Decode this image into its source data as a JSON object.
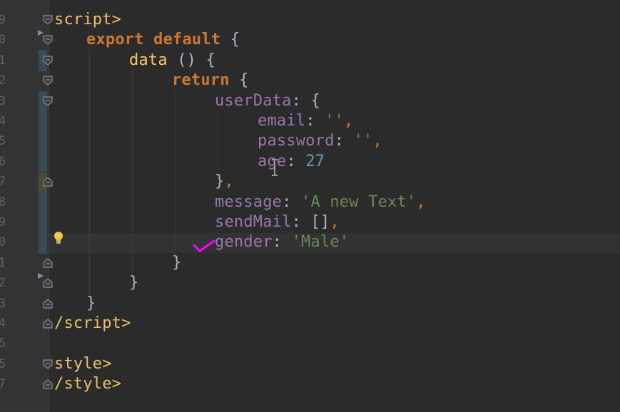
{
  "editor": {
    "line_numbers": [
      "9",
      "0",
      "1",
      "2",
      "3",
      "4",
      "5",
      "6",
      "7",
      "8",
      "9",
      "0",
      "1",
      "2",
      "3",
      "4",
      "5",
      "5",
      "7"
    ],
    "lines": [
      {
        "tokens": [
          {
            "t": "script>",
            "c": "tag"
          }
        ]
      },
      {
        "tokens": [
          {
            "t": "export ",
            "c": "kw"
          },
          {
            "t": "default ",
            "c": "kw"
          },
          {
            "t": "{",
            "c": "plain"
          }
        ]
      },
      {
        "tokens": [
          {
            "t": "data ",
            "c": "fn"
          },
          {
            "t": "() {",
            "c": "plain"
          }
        ]
      },
      {
        "tokens": [
          {
            "t": "return ",
            "c": "kw"
          },
          {
            "t": "{",
            "c": "plain"
          }
        ]
      },
      {
        "tokens": [
          {
            "t": "userData",
            "c": "prop"
          },
          {
            "t": ": {",
            "c": "plain"
          }
        ]
      },
      {
        "tokens": [
          {
            "t": "email",
            "c": "prop"
          },
          {
            "t": ": ",
            "c": "plain"
          },
          {
            "t": "''",
            "c": "str"
          },
          {
            "t": ",",
            "c": "punc"
          }
        ]
      },
      {
        "tokens": [
          {
            "t": "password",
            "c": "prop"
          },
          {
            "t": ": ",
            "c": "plain"
          },
          {
            "t": "''",
            "c": "str"
          },
          {
            "t": ",",
            "c": "punc"
          }
        ]
      },
      {
        "tokens": [
          {
            "t": "age",
            "c": "prop"
          },
          {
            "t": ": ",
            "c": "plain"
          },
          {
            "t": "27",
            "c": "num"
          }
        ]
      },
      {
        "tokens": [
          {
            "t": "}",
            "c": "plain"
          },
          {
            "t": ",",
            "c": "punc"
          }
        ]
      },
      {
        "tokens": [
          {
            "t": "message",
            "c": "prop"
          },
          {
            "t": ": ",
            "c": "plain"
          },
          {
            "t": "'A new Text'",
            "c": "str"
          },
          {
            "t": ",",
            "c": "punc"
          }
        ]
      },
      {
        "tokens": [
          {
            "t": "sendMail",
            "c": "prop"
          },
          {
            "t": ": ",
            "c": "plain"
          },
          {
            "t": "[]",
            "c": "plain"
          },
          {
            "t": ",",
            "c": "punc"
          }
        ]
      },
      {
        "tokens": [
          {
            "t": "gender",
            "c": "prop"
          },
          {
            "t": ": ",
            "c": "plain"
          },
          {
            "t": "'Male'",
            "c": "str"
          }
        ]
      },
      {
        "tokens": [
          {
            "t": "}",
            "c": "plain"
          }
        ]
      },
      {
        "tokens": [
          {
            "t": "}",
            "c": "plain"
          }
        ]
      },
      {
        "tokens": [
          {
            "t": "}",
            "c": "plain"
          }
        ]
      },
      {
        "tokens": [
          {
            "t": "/script>",
            "c": "tag"
          }
        ]
      },
      {
        "tokens": []
      },
      {
        "tokens": [
          {
            "t": "style>",
            "c": "tag"
          }
        ]
      },
      {
        "tokens": [
          {
            "t": "/style>",
            "c": "tag"
          }
        ]
      }
    ]
  },
  "icons": {
    "intention": "lightbulb-icon",
    "annotation": "checkmark-icon",
    "cursor": "text-cursor-icon"
  },
  "colors": {
    "background": "#2b2b2b",
    "gutter": "#313335",
    "tag": "#e8bf6a",
    "keyword": "#cc7832",
    "property": "#9876aa",
    "string": "#6a8759",
    "number": "#6897bb",
    "text": "#a9b7c6",
    "annotation": "#ff00ff"
  }
}
